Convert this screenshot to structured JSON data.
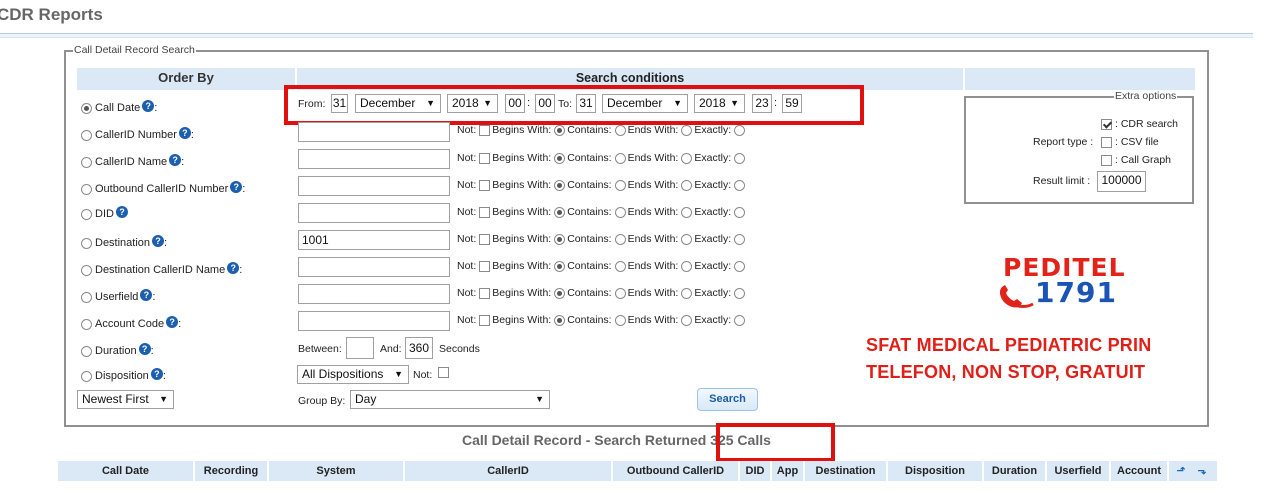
{
  "page_title": "CDR Reports",
  "fieldset_legend": "Call Detail Record Search",
  "headers": {
    "order_by": "Order By",
    "search_conditions": "Search conditions"
  },
  "date_range": {
    "from_label": "From:",
    "from_day": "31",
    "from_month": "December",
    "from_year": "2018",
    "from_hour": "00",
    "from_minute": "00",
    "to_label": "To:",
    "to_day": "31",
    "to_month": "December",
    "to_year": "2018",
    "to_hour": "23",
    "to_minute": "59",
    "colon": ":"
  },
  "order_options": [
    {
      "label": "Call Date",
      "suffix": ":",
      "selected": true
    },
    {
      "label": "CallerID Number",
      "suffix": ":",
      "selected": false
    },
    {
      "label": "CallerID Name",
      "suffix": ":",
      "selected": false
    },
    {
      "label": "Outbound CallerID Number",
      "suffix": ":",
      "selected": false
    },
    {
      "label": "DID",
      "suffix": "",
      "selected": false
    },
    {
      "label": "Destination",
      "suffix": ":",
      "selected": false
    },
    {
      "label": "Destination CallerID Name",
      "suffix": ":",
      "selected": false
    },
    {
      "label": "Userfield",
      "suffix": ":",
      "selected": false
    },
    {
      "label": "Account Code",
      "suffix": ":",
      "selected": false
    },
    {
      "label": "Duration",
      "suffix": ":",
      "selected": false
    },
    {
      "label": "Disposition",
      "suffix": ":",
      "selected": false
    }
  ],
  "help_glyph": "?",
  "match_labels": {
    "not": "Not:",
    "begins": "Begins With:",
    "contains": "Contains:",
    "ends": "Ends With:",
    "exactly": "Exactly:"
  },
  "field_values": [
    "",
    "",
    "",
    "",
    "1001",
    "",
    "",
    ""
  ],
  "duration": {
    "between_label": "Between:",
    "min": "",
    "and_label": "And:",
    "max": "360",
    "unit_label": "Seconds"
  },
  "disposition": {
    "value": "All Dispositions",
    "not_label": "Not:"
  },
  "sort_order": "Newest First",
  "group_by": {
    "label": "Group By:",
    "value": "Day"
  },
  "search_button": "Search",
  "extra_options": {
    "legend": "Extra options",
    "report_type_label": "Report type :",
    "types": [
      {
        "label": ": CDR search",
        "checked": true
      },
      {
        "label": ": CSV file",
        "checked": false
      },
      {
        "label": ": Call Graph",
        "checked": false
      }
    ],
    "result_limit_label": "Result limit :",
    "result_limit": "100000"
  },
  "brand": {
    "name": "PEDITEL",
    "number": "1791",
    "icon": "phone-icon",
    "color_red": "#e2231a",
    "color_blue": "#1a55b5"
  },
  "promo": {
    "line1": "SFAT MEDICAL PEDIATRIC PRIN",
    "line2": "TELEFON, NON STOP, GRATUIT"
  },
  "result": {
    "prefix": "Call Detail Record - Search Returned",
    "count_text": "325 Calls"
  },
  "columns": [
    "Call Date",
    "Recording",
    "System",
    "CallerID",
    "Outbound CallerID",
    "DID",
    "App",
    "Destination",
    "Disposition",
    "Duration",
    "Userfield",
    "Account"
  ],
  "sort_icons": [
    "sort-up-icon",
    "sort-down-icon"
  ]
}
